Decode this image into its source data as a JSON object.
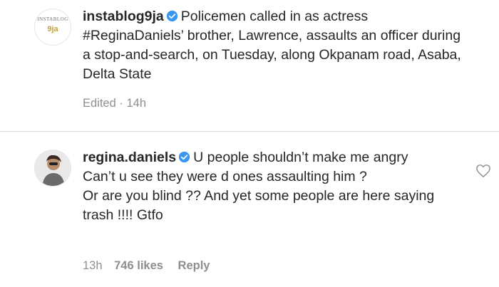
{
  "post": {
    "avatar_brand_top": "INSTABLOG",
    "avatar_brand_main": "9ja",
    "username": "instablog9ja",
    "caption": "Policemen called in as actress #ReginaDaniels’ brother, Lawrence, assaults an officer during a stop-and-search, on Tuesday, along Okpanam road, Asaba, Delta State",
    "edited_label": "Edited",
    "separator": "·",
    "time": "14h"
  },
  "comment": {
    "username": "regina.daniels",
    "text_line1": "U people shouldn’t make me angry",
    "text_line2": "Can’t u see they were d ones assaulting him ?",
    "text_line3": "Or are you blind ?? And yet some people are here saying trash !!!! Gtfo",
    "time": "13h",
    "likes": "746 likes",
    "reply_label": "Reply"
  },
  "colors": {
    "verified_badge": "#3897f0",
    "meta_text": "#8e8e8e",
    "primary_text": "#262626"
  },
  "icons": {
    "verified": "verified-badge-icon",
    "like": "heart-outline-icon"
  }
}
